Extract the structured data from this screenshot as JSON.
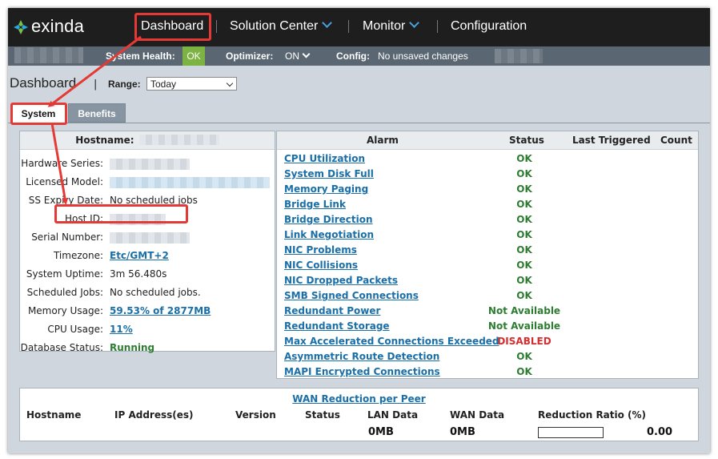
{
  "brand": {
    "name": "exinda"
  },
  "nav": {
    "items": [
      {
        "label": "Dashboard",
        "has_dropdown": false
      },
      {
        "label": "Solution Center",
        "has_dropdown": true
      },
      {
        "label": "Monitor",
        "has_dropdown": true
      },
      {
        "label": "Configuration",
        "has_dropdown": false
      }
    ]
  },
  "statusbar": {
    "system_health_label": "System Health:",
    "system_health_value": "OK",
    "optimizer_label": "Optimizer:",
    "optimizer_value": "ON",
    "config_label": "Config:",
    "config_value": "No unsaved changes"
  },
  "page": {
    "title": "Dashboard",
    "range_label": "Range:",
    "range_value": "Today"
  },
  "tabs": [
    {
      "label": "System",
      "active": true
    },
    {
      "label": "Benefits",
      "active": false
    }
  ],
  "system_info": {
    "hostname_label": "Hostname:",
    "rows": [
      {
        "label": "Hardware Series:",
        "value": "",
        "style": "blur"
      },
      {
        "label": "Licensed Model:",
        "value": "",
        "style": "blur-blue"
      },
      {
        "label": "SS Expiry Date:",
        "value": "No scheduled jobs",
        "style": "plain"
      },
      {
        "label": "Host ID:",
        "value": "",
        "style": "blur"
      },
      {
        "label": "Serial Number:",
        "value": "",
        "style": "blur"
      },
      {
        "label": "Timezone:",
        "value": "Etc/GMT+2",
        "style": "link"
      },
      {
        "label": "System Uptime:",
        "value": "3m 56.480s",
        "style": "plain"
      },
      {
        "label": "Scheduled Jobs:",
        "value": "No scheduled jobs.",
        "style": "plain"
      },
      {
        "label": "Memory Usage:",
        "value": "59.53% of 2877MB",
        "style": "link"
      },
      {
        "label": "CPU Usage:",
        "value": "11%",
        "style": "link"
      },
      {
        "label": "Database Status:",
        "value": "Running",
        "style": "green"
      }
    ]
  },
  "alarms": {
    "columns": {
      "alarm": "Alarm",
      "status": "Status",
      "last_triggered": "Last Triggered",
      "count": "Count"
    },
    "rows": [
      {
        "name": "CPU Utilization",
        "status": "OK",
        "kind": "ok"
      },
      {
        "name": "System Disk Full",
        "status": "OK",
        "kind": "ok"
      },
      {
        "name": "Memory Paging",
        "status": "OK",
        "kind": "ok"
      },
      {
        "name": "Bridge Link",
        "status": "OK",
        "kind": "ok"
      },
      {
        "name": "Bridge Direction",
        "status": "OK",
        "kind": "ok"
      },
      {
        "name": "Link Negotiation",
        "status": "OK",
        "kind": "ok"
      },
      {
        "name": "NIC Problems",
        "status": "OK",
        "kind": "ok"
      },
      {
        "name": "NIC Collisions",
        "status": "OK",
        "kind": "ok"
      },
      {
        "name": "NIC Dropped Packets",
        "status": "OK",
        "kind": "ok"
      },
      {
        "name": "SMB Signed Connections",
        "status": "OK",
        "kind": "ok"
      },
      {
        "name": "Redundant Power",
        "status": "Not Available",
        "kind": "na"
      },
      {
        "name": "Redundant Storage",
        "status": "Not Available",
        "kind": "na"
      },
      {
        "name": "Max Accelerated Connections Exceeded",
        "status": "DISABLED",
        "kind": "dis"
      },
      {
        "name": "Asymmetric Route Detection",
        "status": "OK",
        "kind": "ok"
      },
      {
        "name": "MAPI Encrypted Connections",
        "status": "OK",
        "kind": "ok"
      }
    ]
  },
  "wan": {
    "title": "WAN Reduction per Peer",
    "columns": {
      "hostname": "Hostname",
      "ip": "IP Address(es)",
      "version": "Version",
      "status": "Status",
      "lan": "LAN Data",
      "wan": "WAN Data",
      "ratio": "Reduction Ratio (%)"
    },
    "totals": {
      "lan": "0MB",
      "wan": "0MB",
      "ratio": "0.00"
    },
    "ratio_fill": 0
  },
  "colors": {
    "nav_bg": "#1e1e1e",
    "status_bg": "#5a6772",
    "ok_badge": "#7cb342",
    "link": "#1a6fa8",
    "ok_text": "#2e7d32",
    "disabled_text": "#d32f2f",
    "annotation": "#e53935"
  }
}
